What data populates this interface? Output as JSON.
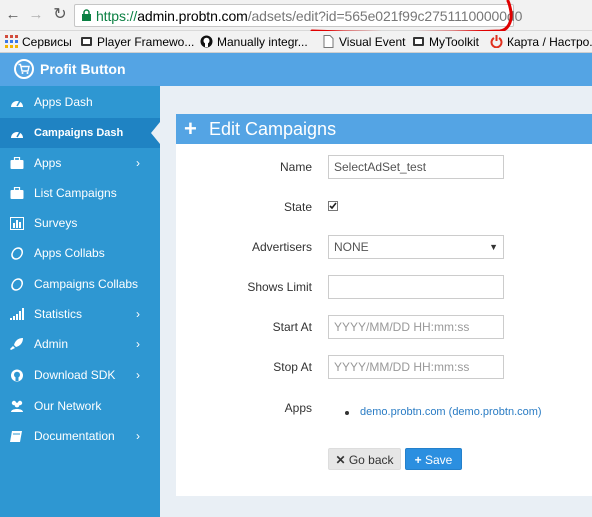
{
  "browser": {
    "url_scheme": "https://",
    "url_host": "admin.probtn.com",
    "url_path": "/adsets/edit?id=565e021f99c27511100000d0",
    "bookmarks": [
      {
        "label": "Сервисы",
        "icon": "apps-grid-icon"
      },
      {
        "label": "Player Framewo...",
        "icon": "bookmark-page-icon"
      },
      {
        "label": "Manually integr...",
        "icon": "github-icon"
      },
      {
        "label": "Visual Event",
        "icon": "document-icon"
      },
      {
        "label": "MyToolkit",
        "icon": "bookmark-page-icon"
      },
      {
        "label": "Карта / Настро...",
        "icon": "power-icon"
      }
    ],
    "annotation_color": "#e00000"
  },
  "app": {
    "brand": "Profit Button",
    "header_color": "#54a4e4",
    "sidebar_color": "#2e97d2"
  },
  "sidebar": {
    "items": [
      {
        "label": "Apps Dash",
        "icon": "dashboard-icon",
        "chevron": false,
        "active": false
      },
      {
        "label": "Campaigns Dash",
        "icon": "dashboard-icon",
        "chevron": false,
        "active": true
      },
      {
        "label": "Apps",
        "icon": "briefcase-icon",
        "chevron": true,
        "active": false
      },
      {
        "label": "List Campaigns",
        "icon": "briefcase-icon",
        "chevron": false,
        "active": false
      },
      {
        "label": "Surveys",
        "icon": "bar-chart-icon",
        "chevron": false,
        "active": false
      },
      {
        "label": "Apps Collabs",
        "icon": "circle-outline-icon",
        "chevron": false,
        "active": false
      },
      {
        "label": "Campaigns Collabs",
        "icon": "circle-outline-icon",
        "chevron": false,
        "active": false
      },
      {
        "label": "Statistics",
        "icon": "signal-icon",
        "chevron": true,
        "active": false
      },
      {
        "label": "Admin",
        "icon": "rocket-icon",
        "chevron": true,
        "active": false
      },
      {
        "label": "Download SDK",
        "icon": "github-icon",
        "chevron": true,
        "active": false
      },
      {
        "label": "Our Network",
        "icon": "users-icon",
        "chevron": false,
        "active": false
      },
      {
        "label": "Documentation",
        "icon": "book-icon",
        "chevron": true,
        "active": false
      }
    ],
    "chevron_glyph": "›"
  },
  "form": {
    "title": "Edit Campaigns",
    "name_label": "Name",
    "name_value": "SelectAdSet_test",
    "state_label": "State",
    "state_checked": true,
    "advertisers_label": "Advertisers",
    "advertisers_value": "NONE",
    "shows_limit_label": "Shows Limit",
    "shows_limit_value": "",
    "start_label": "Start At",
    "start_placeholder": "YYYY/MM/DD HH:mm:ss",
    "stop_label": "Stop At",
    "stop_placeholder": "YYYY/MM/DD HH:mm:ss",
    "apps_label": "Apps",
    "apps": [
      "demo.probtn.com (demo.probtn.com)"
    ],
    "back_label": "Go back",
    "save_label": "Save"
  }
}
